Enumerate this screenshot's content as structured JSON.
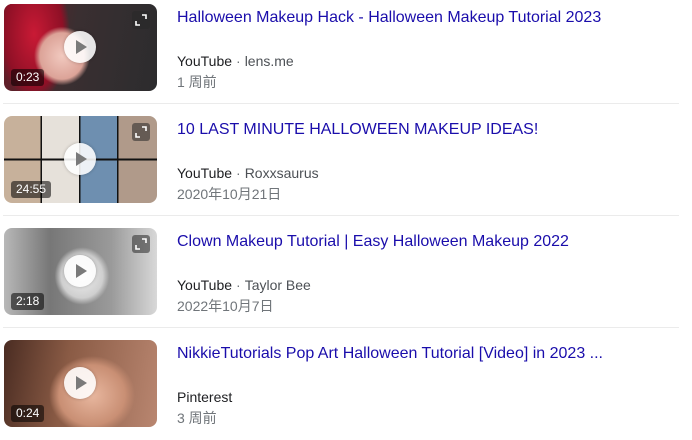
{
  "results": [
    {
      "title": "Halloween Makeup Hack - Halloween Makeup Tutorial 2023",
      "duration": "0:23",
      "source": "YouTube",
      "channel": "lens.me",
      "date": "1 周前",
      "has_expand_icon": true
    },
    {
      "title": "10 LAST MINUTE HALLOWEEN MAKEUP IDEAS!",
      "duration": "24:55",
      "source": "YouTube",
      "channel": "Roxxsaurus",
      "date": "2020年10月21日",
      "has_expand_icon": true
    },
    {
      "title": "Clown Makeup Tutorial | Easy Halloween Makeup 2022",
      "duration": "2:18",
      "source": "YouTube",
      "channel": "Taylor Bee",
      "date": "2022年10月7日",
      "has_expand_icon": true
    },
    {
      "title": "NikkieTutorials Pop Art Halloween Tutorial [Video] in 2023 ...",
      "duration": "0:24",
      "source": "Pinterest",
      "channel": "",
      "date": "3 周前",
      "has_expand_icon": false
    }
  ],
  "colors": {
    "link": "#1a0dab",
    "meta": "#4d5156",
    "date": "#70757a",
    "separator": "#ebebeb"
  },
  "icons": {
    "play": "play-icon",
    "expand": "expand-icon"
  }
}
